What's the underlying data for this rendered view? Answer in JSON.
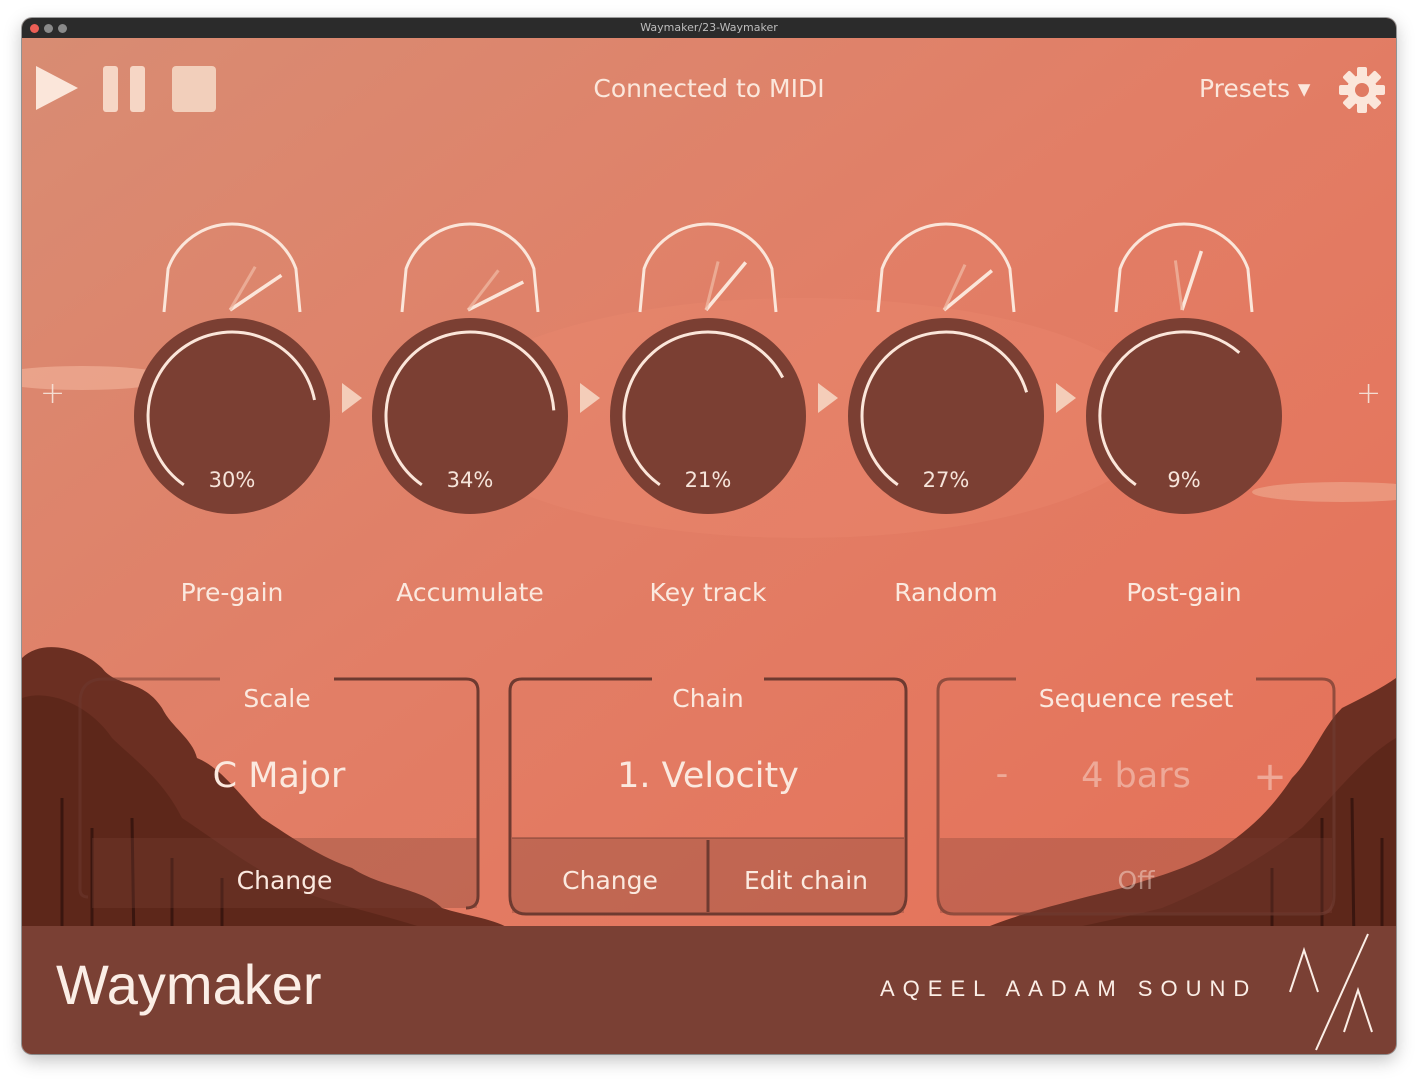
{
  "window": {
    "title": "Waymaker/23-Waymaker"
  },
  "transport": {
    "play": "play-icon",
    "pause": "pause-icon",
    "stop": "stop-icon"
  },
  "header": {
    "status": "Connected to MIDI",
    "presets_label": "Presets ▾",
    "settings": "gear-icon"
  },
  "knobs": [
    {
      "label": "Pre-gain",
      "value": "30%",
      "level": 0.3
    },
    {
      "label": "Accumulate",
      "value": "34%",
      "level": 0.34
    },
    {
      "label": "Key track",
      "value": "21%",
      "level": 0.21
    },
    {
      "label": "Random",
      "value": "27%",
      "level": 0.27
    },
    {
      "label": "Post-gain",
      "value": "9%",
      "level": 0.09
    }
  ],
  "chain_add": {
    "left": "+",
    "right": "+"
  },
  "scale": {
    "title": "Scale",
    "value": "C Major",
    "change_label": "Change"
  },
  "chain": {
    "title": "Chain",
    "value": "1. Velocity",
    "change_label": "Change",
    "edit_label": "Edit chain"
  },
  "sequence_reset": {
    "title": "Sequence reset",
    "value": "4 bars",
    "minus": "-",
    "plus": "+",
    "toggle_label": "Off"
  },
  "footer": {
    "app_name": "Waymaker",
    "vendor": "AQEEL AADAM SOUND",
    "logo": "AA"
  },
  "colors": {
    "knob": "#7b3f33",
    "panel_border": "#6e3a30",
    "footer": "#7a4034",
    "accent_text": "#fbe9df"
  }
}
